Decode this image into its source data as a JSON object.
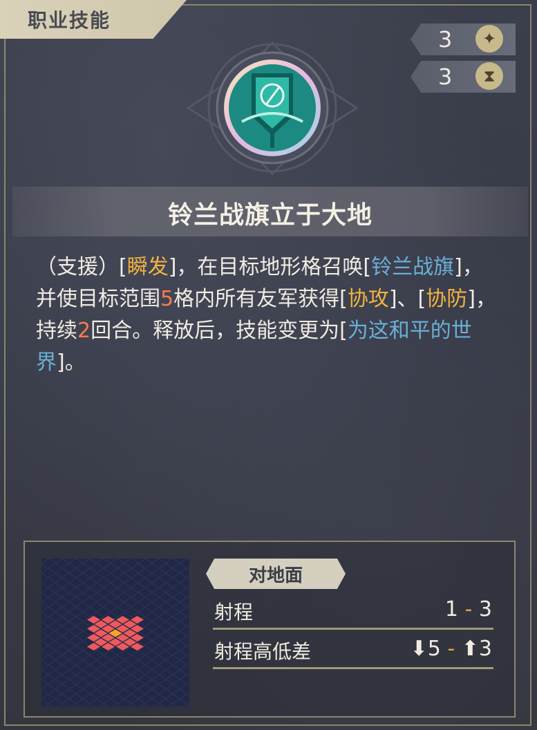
{
  "header": {
    "tag": "职业技能"
  },
  "stats": [
    {
      "value": "3",
      "icon": "star-icon"
    },
    {
      "value": "3",
      "icon": "hourglass-icon"
    }
  ],
  "skill": {
    "name": "铃兰战旗立于大地",
    "description": {
      "p1": "（支援）[",
      "k1": "瞬发",
      "p2": "]，在目标地形格召唤[",
      "k2": "铃兰战旗",
      "p3": "]，并使目标范围",
      "k3": "5",
      "p4": "格内所有友军获得[",
      "k4": "协攻",
      "p5": "]、[",
      "k5": "协防",
      "p6": "]，持续",
      "k6": "2",
      "p7": "回合。释放后，技能变更为[",
      "k7": "为这和平的世界",
      "p8": "]。"
    }
  },
  "range": {
    "target_label": "对地面",
    "range_label": "射程",
    "range_min": "1",
    "range_max": "3",
    "height_label": "射程高低差",
    "height_down": "5",
    "height_up": "3"
  },
  "colors": {
    "accent_orange": "#f2b441",
    "accent_blue": "#6ab0d6",
    "accent_red": "#ff7a4d",
    "range_cell": "#ee5a5c",
    "center_cell": "#f7a823"
  }
}
